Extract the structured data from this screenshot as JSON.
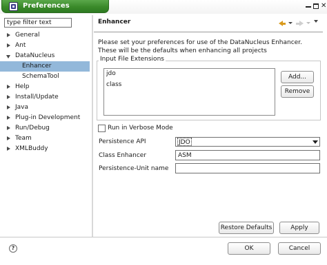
{
  "window": {
    "title": "Preferences"
  },
  "sidebar": {
    "filter_placeholder": "type filter text",
    "items": [
      {
        "label": "General",
        "expanded": false
      },
      {
        "label": "Ant",
        "expanded": false
      },
      {
        "label": "DataNucleus",
        "expanded": true
      },
      {
        "label": "Enhancer",
        "selected": true
      },
      {
        "label": "SchemaTool"
      },
      {
        "label": "Help",
        "expanded": false
      },
      {
        "label": "Install/Update",
        "expanded": false
      },
      {
        "label": "Java",
        "expanded": false
      },
      {
        "label": "Plug-in Development",
        "expanded": false
      },
      {
        "label": "Run/Debug",
        "expanded": false
      },
      {
        "label": "Team",
        "expanded": false
      },
      {
        "label": "XMLBuddy",
        "expanded": false
      }
    ]
  },
  "page": {
    "title": "Enhancer",
    "description_line1": "Please set your preferences for use of the DataNucleus Enhancer.",
    "description_line2": "These will be the defaults when enhancing all projects",
    "extensions_group_label": "Input File Extensions",
    "extensions": [
      "jdo",
      "class"
    ],
    "add_label": "Add...",
    "remove_label": "Remove",
    "verbose_label": "Run in Verbose Mode",
    "verbose_checked": false,
    "persistence_api_label": "Persistence API",
    "persistence_api_value": "JDO",
    "class_enhancer_label": "Class Enhancer",
    "class_enhancer_value": "ASM",
    "persistence_unit_label": "Persistence-Unit name",
    "persistence_unit_value": "",
    "restore_defaults_label": "Restore Defaults",
    "apply_label": "Apply"
  },
  "footer": {
    "help_glyph": "?",
    "ok_label": "OK",
    "cancel_label": "Cancel"
  },
  "colors": {
    "title_tab": "#3a8a2a",
    "selection": "#93b8da",
    "back_arrow": "#d99a1e"
  },
  "icons": [
    "window-icon",
    "back-arrow-icon",
    "forward-arrow-icon",
    "view-menu-icon",
    "help-icon",
    "expand-triangle-icon",
    "collapse-triangle-icon"
  ]
}
